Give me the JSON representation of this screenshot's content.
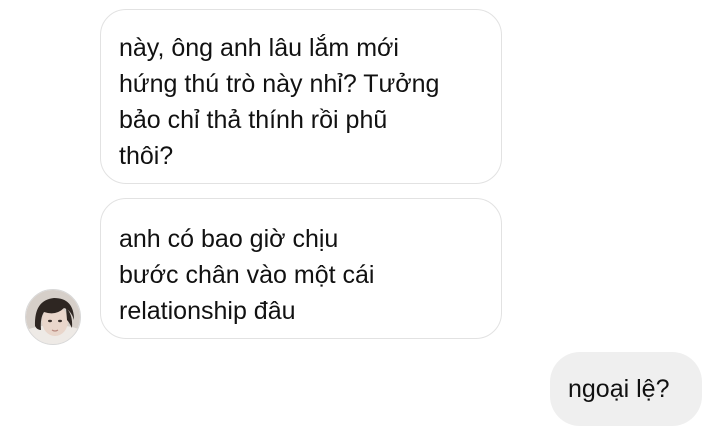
{
  "messages": [
    {
      "direction": "incoming",
      "lines": [
        "này, ông anh lâu lắm mới",
        "hứng thú trò này nhỉ? Tưởng",
        "bảo chỉ thả thính rồi phũ",
        "thôi?"
      ]
    },
    {
      "direction": "incoming",
      "lines": [
        "anh có bao giờ chịu",
        "bước chân vào một cái",
        "relationship đâu"
      ]
    },
    {
      "direction": "outgoing",
      "lines": [
        "ngoại lệ?"
      ]
    }
  ],
  "sender_avatar": {
    "icon": "profile-avatar-photo"
  },
  "colors": {
    "background": "#ffffff",
    "incoming_bubble_border": "#e2e2e2",
    "outgoing_bubble": "#efefef",
    "text": "#111111"
  }
}
